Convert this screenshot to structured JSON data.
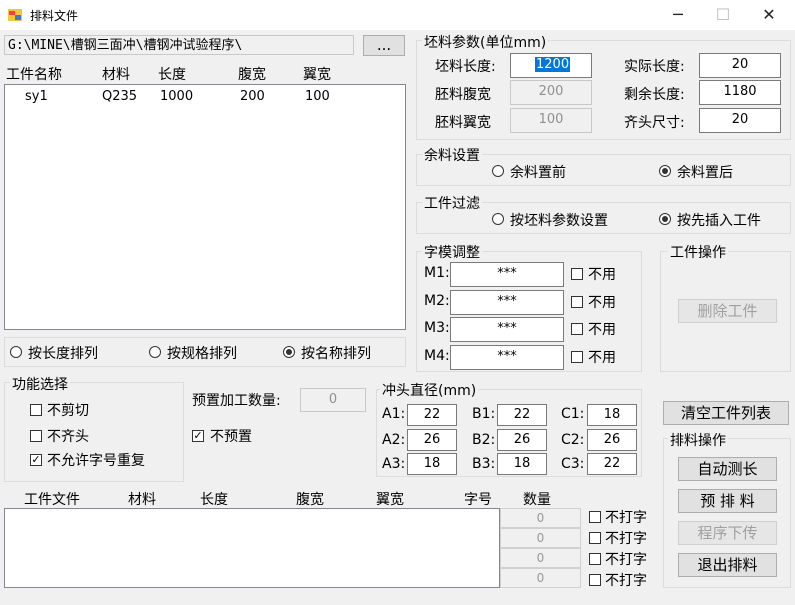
{
  "window": {
    "title": "排料文件",
    "minimize": "─",
    "maximize": "☐",
    "close": "✕"
  },
  "path": {
    "value": "G:\\MINE\\槽钢三面冲\\槽钢冲试验程序\\",
    "browse": "..."
  },
  "list1": {
    "headers": [
      "工件名称",
      "材料",
      "长度",
      "腹宽",
      "翼宽"
    ],
    "rows": [
      [
        "sy1",
        "Q235",
        "1000",
        "200",
        "100"
      ]
    ]
  },
  "sort": {
    "options": [
      "按长度排列",
      "按规格排列",
      "按名称排列"
    ],
    "selected": 2
  },
  "blank": {
    "title": "坯料参数(单位mm)",
    "length_label": "坯料长度:",
    "length": "1200",
    "web_label": "胚料腹宽",
    "web": "200",
    "flange_label": "胚料翼宽",
    "flange": "100",
    "actual_label": "实际长度:",
    "actual": "20",
    "remain_label": "剩余长度:",
    "remain": "1180",
    "head_label": "齐头尺寸:",
    "head": "20"
  },
  "remnant": {
    "title": "余料设置",
    "options": [
      "余料置前",
      "余料置后"
    ],
    "selected": 1
  },
  "filter": {
    "title": "工件过滤",
    "options": [
      "按坯料参数设置",
      "按先插入工件"
    ],
    "selected": 1
  },
  "font_adjust": {
    "title": "字模调整",
    "rows": [
      {
        "label": "M1:",
        "value": "***",
        "check": "不用"
      },
      {
        "label": "M2:",
        "value": "***",
        "check": "不用"
      },
      {
        "label": "M3:",
        "value": "***",
        "check": "不用"
      },
      {
        "label": "M4:",
        "value": "***",
        "check": "不用"
      }
    ]
  },
  "workpiece_ops": {
    "title": "工件操作",
    "delete": "删除工件"
  },
  "functions": {
    "title": "功能选择",
    "items": [
      {
        "label": "不剪切",
        "checked": false
      },
      {
        "label": "不齐头",
        "checked": false
      },
      {
        "label": "不允许字号重复",
        "checked": true
      }
    ]
  },
  "preset": {
    "label": "预置加工数量:",
    "value": "0",
    "check_label": "不预置",
    "checked": true
  },
  "punch": {
    "title": "冲头直径(mm)",
    "cells": [
      {
        "label": "A1:",
        "value": "22"
      },
      {
        "label": "B1:",
        "value": "22"
      },
      {
        "label": "C1:",
        "value": "18"
      },
      {
        "label": "A2:",
        "value": "26"
      },
      {
        "label": "B2:",
        "value": "26"
      },
      {
        "label": "C2:",
        "value": "26"
      },
      {
        "label": "A3:",
        "value": "18"
      },
      {
        "label": "B3:",
        "value": "18"
      },
      {
        "label": "C3:",
        "value": "22"
      }
    ]
  },
  "clear_list": "清空工件列表",
  "nest_ops": {
    "title": "排料操作",
    "auto_measure": "自动测长",
    "pre_nest": "预 排 料",
    "download": "程序下传",
    "exit": "退出排料"
  },
  "list2": {
    "headers": [
      "工件文件",
      "材料",
      "长度",
      "腹宽",
      "翼宽",
      "字号",
      "数量"
    ]
  },
  "qty_rows": [
    {
      "value": "0",
      "check": "不打字"
    },
    {
      "value": "0",
      "check": "不打字"
    },
    {
      "value": "0",
      "check": "不打字"
    },
    {
      "value": "0",
      "check": "不打字"
    }
  ],
  "colors": {
    "selection": "#0078d7",
    "background": "#f0f0f0"
  }
}
